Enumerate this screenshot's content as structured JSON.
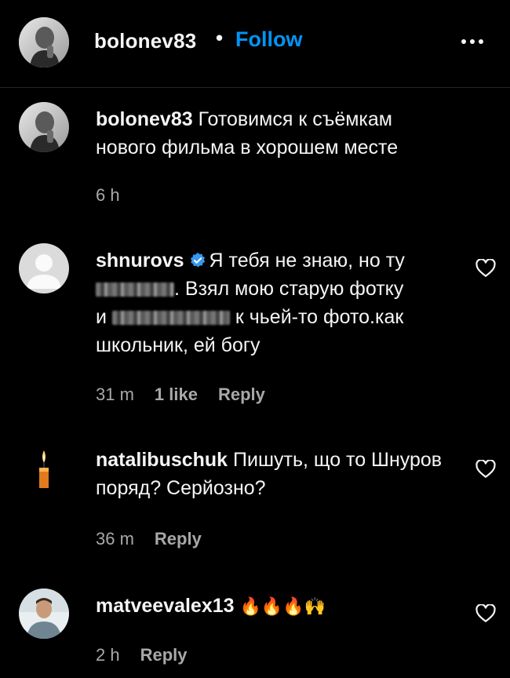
{
  "header": {
    "username": "bolonev83",
    "separator": "•",
    "follow_label": "Follow"
  },
  "caption": {
    "username": "bolonev83",
    "text": "Готовимся к съёмкам нового фильма в хорошем месте",
    "time": "6 h"
  },
  "comments": [
    {
      "username": "shnurovs",
      "verified": true,
      "text_part1": "Я тебя не знаю, но ту",
      "text_part2": ". Взял мою старую фотку",
      "text_part3": "и",
      "text_part4": "к чьей-то фото.как",
      "text_part5": "школьник, ей богу",
      "time": "31 m",
      "likes": "1 like",
      "reply_label": "Reply"
    },
    {
      "username": "natalibuschuk",
      "text": "Пишуть, що то Шнуров поряд? Серйозно?",
      "time": "36 m",
      "reply_label": "Reply"
    },
    {
      "username": "matveevalex13",
      "text": "🔥🔥🔥🙌",
      "time": "2 h",
      "reply_label": "Reply"
    }
  ],
  "colors": {
    "background": "#000000",
    "text": "#f5f5f5",
    "muted": "#a8a8a8",
    "follow": "#0095f6",
    "verified": "#3897f0"
  }
}
